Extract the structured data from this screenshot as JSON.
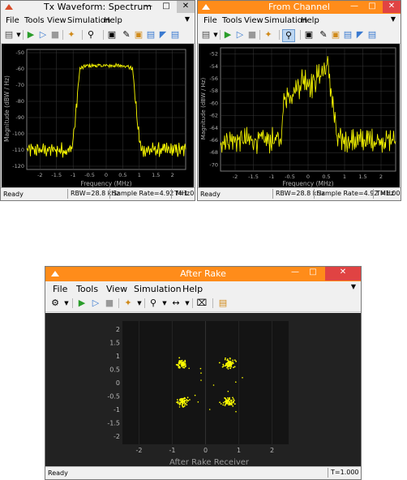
{
  "colors": {
    "plot_bg": "#000000",
    "grid": "#3a3a3a",
    "trace": "#ffff00",
    "axis_text": "#b0b0b0",
    "win_bg": "#f0f0f0",
    "close_red": "#e04343",
    "titlebar_orange": "#ff8c1a"
  },
  "menu": [
    "File",
    "Tools",
    "View",
    "Simulation",
    "Help"
  ],
  "icons": [
    "new-scope-icon",
    "run-icon",
    "step-forward-icon",
    "stop-icon",
    "highlight-icon",
    "zoom-in-icon",
    "fit-icon",
    "edit-icon",
    "cursor-icon",
    "export-icon",
    "measure-icon",
    "marker-icon"
  ],
  "window1": {
    "title": "Tx Waveform: Spectrum",
    "status": {
      "ready": "Ready",
      "rbw": "RBW=28.8 kHz",
      "rate": "Sample Rate=4.92 MHz",
      "time": "T=1.000"
    },
    "ylabel": "Magnitude (dBW / Hz)",
    "xlabel": "Frequency (MHz)",
    "xticks": [
      "-2",
      "-1.5",
      "-1",
      "-0.5",
      "0",
      "0.5",
      "1",
      "1.5",
      "2"
    ],
    "yticks": [
      "-50",
      "-60",
      "-70",
      "-80",
      "-90",
      "-100",
      "-110",
      "-120"
    ]
  },
  "window2": {
    "title": "From Channel",
    "status": {
      "ready": "Ready",
      "rbw": "RBW=28.8 kHz",
      "rate": "Sample Rate=4.92 MHz",
      "time": "T=1.000"
    },
    "ylabel": "Magnitude (dBW / Hz)",
    "xlabel": "Frequency (MHz)",
    "xticks": [
      "-2",
      "-1.5",
      "-1",
      "-0.5",
      "0",
      "0.5",
      "1",
      "1.5",
      "2"
    ],
    "yticks": [
      "-52",
      "-54",
      "-56",
      "-58",
      "-60",
      "-62",
      "-64",
      "-66",
      "-68",
      "-70"
    ]
  },
  "window3": {
    "title": "After Rake",
    "status": {
      "ready": "Ready",
      "time": "T=1.000"
    },
    "xlabel": "After Rake Receiver",
    "xticks": [
      "-2",
      "-1",
      "0",
      "1",
      "2"
    ],
    "yticks": [
      "2",
      "1.5",
      "1",
      "0.5",
      "0",
      "-0.5",
      "-1",
      "-1.5",
      "-2"
    ]
  },
  "chart_data": [
    {
      "type": "line",
      "xlabel": "Frequency (MHz)",
      "ylabel": "Magnitude (dBW / Hz)",
      "xlim": [
        -2.4,
        2.4
      ],
      "ylim": [
        -122,
        -48
      ],
      "series": [
        {
          "x": [
            -2.4,
            -1.05,
            -0.95,
            -0.8,
            -0.6,
            -0.3,
            0,
            0.3,
            0.6,
            0.8,
            0.95,
            1.05,
            2.4
          ],
          "y": [
            -110,
            -110,
            -95,
            -60,
            -58,
            -58,
            -58,
            -58,
            -58,
            -60,
            -95,
            -110,
            -110
          ]
        }
      ]
    },
    {
      "type": "line",
      "xlabel": "Frequency (MHz)",
      "ylabel": "Magnitude (dBW / Hz)",
      "xlim": [
        -2.4,
        2.4
      ],
      "ylim": [
        -71,
        -51
      ],
      "series": [
        {
          "x": [
            -2.4,
            -1.0,
            -0.75,
            -0.65,
            -0.4,
            -0.1,
            0.1,
            0.35,
            0.55,
            0.65,
            0.8,
            2.4
          ],
          "y": [
            -66,
            -66,
            -66,
            -59,
            -58,
            -56,
            -57,
            -55,
            -54,
            -59,
            -66,
            -66
          ]
        }
      ]
    },
    {
      "type": "scatter",
      "xlabel": "After Rake Receiver",
      "xlim": [
        -2.5,
        2.5
      ],
      "ylim": [
        -2.3,
        2.3
      ],
      "series": [
        {
          "clusters": [
            [
              -0.7,
              0.7
            ],
            [
              0.7,
              0.7
            ],
            [
              -0.7,
              -0.7
            ],
            [
              0.7,
              -0.7
            ]
          ]
        }
      ]
    }
  ]
}
